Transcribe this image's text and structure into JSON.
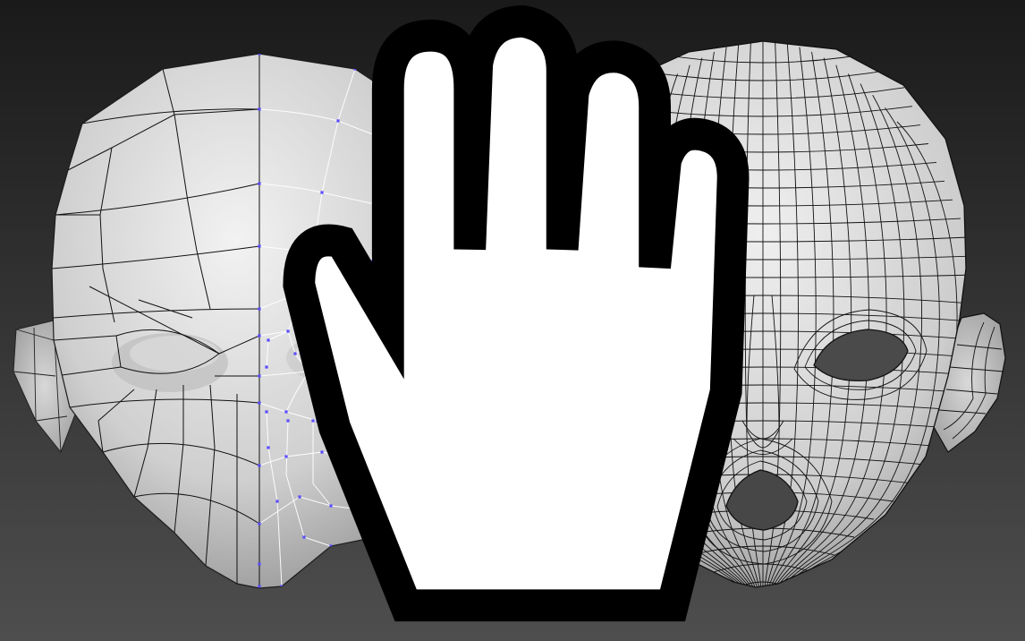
{
  "viewport": {
    "background_top": "#1a1a1a",
    "background_bottom": "#4e4e4e",
    "surface_light": "#f0f0f0",
    "surface_shadow": "#8a8a8a",
    "wire_color": "#111111",
    "selected_wire_color": "#ffffff",
    "vertex_color": "#5a4cff"
  },
  "models": [
    {
      "name": "low-poly-head",
      "mode": "vertex-selection"
    },
    {
      "name": "subdivided-head",
      "mode": "wireframe-on-shaded"
    }
  ],
  "cursor": {
    "icon": "hand-pan-icon"
  }
}
